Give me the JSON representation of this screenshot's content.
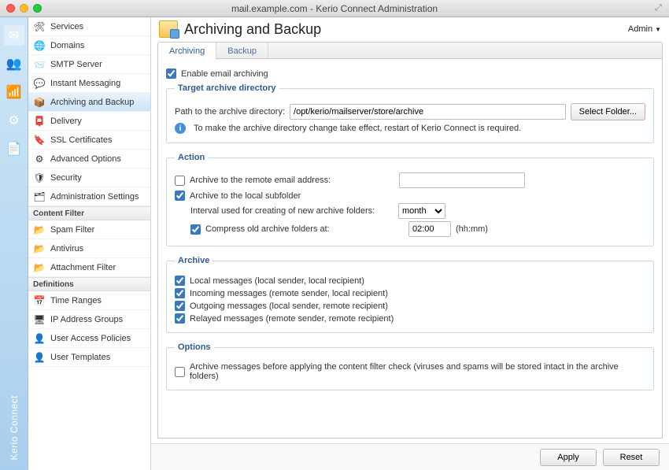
{
  "window": {
    "title": "mail.example.com - Kerio Connect Administration"
  },
  "brand": "Kerio Connect",
  "header": {
    "title": "Archiving and Backup",
    "admin_label": "Admin"
  },
  "iconbar": [
    {
      "name": "mail-icon",
      "glyph": "✉"
    },
    {
      "name": "users-icon",
      "glyph": "👥"
    },
    {
      "name": "stats-icon",
      "glyph": "📶"
    },
    {
      "name": "settings-icon",
      "glyph": "⚙"
    },
    {
      "name": "logs-icon",
      "glyph": "📄"
    }
  ],
  "nav": {
    "config_items": [
      {
        "label": "Services",
        "icon": "services-icon",
        "glyph": "🛠"
      },
      {
        "label": "Domains",
        "icon": "globe-icon",
        "glyph": "🌐"
      },
      {
        "label": "SMTP Server",
        "icon": "smtp-icon",
        "glyph": "📨"
      },
      {
        "label": "Instant Messaging",
        "icon": "chat-icon",
        "glyph": "💬"
      },
      {
        "label": "Archiving and Backup",
        "icon": "archive-icon",
        "glyph": "📦",
        "selected": true
      },
      {
        "label": "Delivery",
        "icon": "delivery-icon",
        "glyph": "📮"
      },
      {
        "label": "SSL Certificates",
        "icon": "cert-icon",
        "glyph": "🔖"
      },
      {
        "label": "Advanced Options",
        "icon": "advanced-icon",
        "glyph": "⚙"
      },
      {
        "label": "Security",
        "icon": "security-icon",
        "glyph": "🛡"
      },
      {
        "label": "Administration Settings",
        "icon": "admin-icon",
        "glyph": "🗂"
      }
    ],
    "filter_header": "Content Filter",
    "filter_items": [
      {
        "label": "Spam Filter",
        "icon": "spam-icon",
        "glyph": "📂"
      },
      {
        "label": "Antivirus",
        "icon": "antivirus-icon",
        "glyph": "📂"
      },
      {
        "label": "Attachment Filter",
        "icon": "attach-icon",
        "glyph": "📂"
      }
    ],
    "def_header": "Definitions",
    "def_items": [
      {
        "label": "Time Ranges",
        "icon": "time-icon",
        "glyph": "📅"
      },
      {
        "label": "IP Address Groups",
        "icon": "ip-icon",
        "glyph": "🖥"
      },
      {
        "label": "User Access Policies",
        "icon": "policy-icon",
        "glyph": "👤"
      },
      {
        "label": "User Templates",
        "icon": "template-icon",
        "glyph": "👤"
      }
    ]
  },
  "tabs": [
    {
      "label": "Archiving",
      "active": true
    },
    {
      "label": "Backup",
      "active": false
    }
  ],
  "archiving": {
    "enable_label": "Enable email archiving",
    "enable_checked": true,
    "target": {
      "legend": "Target archive directory",
      "path_label": "Path to the archive directory:",
      "path_value": "/opt/kerio/mailserver/store/archive",
      "select_folder": "Select Folder...",
      "info": "To make the archive directory change take effect, restart of Kerio Connect is required."
    },
    "action": {
      "legend": "Action",
      "remote_label": "Archive to the remote email address:",
      "remote_checked": false,
      "remote_value": "",
      "local_label": "Archive to the local subfolder",
      "local_checked": true,
      "interval_label": "Interval used for creating of new archive folders:",
      "interval_value": "month",
      "compress_label": "Compress old archive folders at:",
      "compress_checked": true,
      "compress_time": "02:00",
      "time_hint": "(hh:mm)"
    },
    "archive": {
      "legend": "Archive",
      "items": [
        {
          "label": "Local messages (local sender, local recipient)",
          "checked": true
        },
        {
          "label": "Incoming messages (remote sender, local recipient)",
          "checked": true
        },
        {
          "label": "Outgoing messages (local sender, remote recipient)",
          "checked": true
        },
        {
          "label": "Relayed messages (remote sender, remote recipient)",
          "checked": true
        }
      ]
    },
    "options": {
      "legend": "Options",
      "before_filter_label": "Archive messages before applying the content filter check (viruses and spams will be stored intact in the archive folders)",
      "before_filter_checked": false
    }
  },
  "footer": {
    "apply": "Apply",
    "reset": "Reset"
  }
}
